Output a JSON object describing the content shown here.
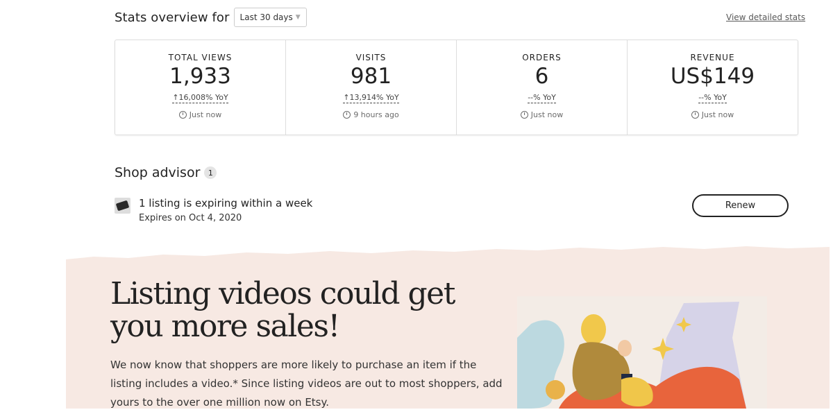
{
  "stats": {
    "title": "Stats overview for",
    "period": "Last 30 days",
    "view_detailed": "View detailed stats",
    "cards": [
      {
        "label": "TOTAL VIEWS",
        "value": "1,933",
        "yoy": "16,008% YoY",
        "arrow": "↑",
        "time": "Just now"
      },
      {
        "label": "VISITS",
        "value": "981",
        "yoy": "13,914% YoY",
        "arrow": "↑",
        "time": "9 hours ago"
      },
      {
        "label": "ORDERS",
        "value": "6",
        "yoy": "--% YoY",
        "arrow": "",
        "time": "Just now"
      },
      {
        "label": "REVENUE",
        "value": "US$149",
        "yoy": "--% YoY",
        "arrow": "",
        "time": "Just now"
      }
    ]
  },
  "advisor": {
    "title": "Shop advisor",
    "count": "1",
    "item_text": "1 listing is expiring within a week",
    "item_sub": "Expires on Oct 4, 2020",
    "renew_label": "Renew"
  },
  "promo": {
    "title": "Listing videos could get you more sales!",
    "body": "We now know that shoppers are more likely to purchase an item if the listing includes a video.* Since listing videos are out to most shoppers, add yours to the over one million now on Etsy.",
    "bg_color": "#f7e9e3"
  }
}
